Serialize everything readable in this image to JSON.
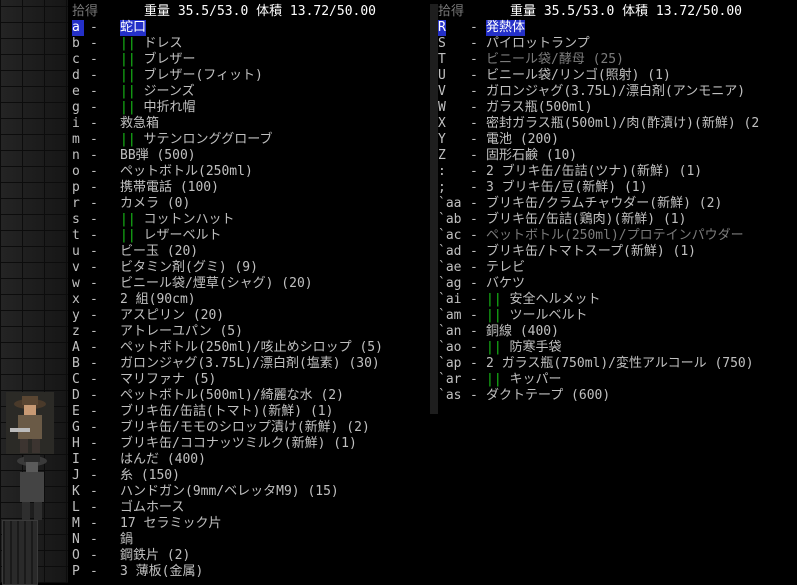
{
  "header": {
    "title": "拾得",
    "stats": "重量 35.5/53.0 体積 13.72/50.00"
  },
  "left_items": [
    {
      "key": "a",
      "name": "蛇口",
      "sel": true
    },
    {
      "key": "b",
      "worn": "||",
      "name": "ドレス"
    },
    {
      "key": "c",
      "worn": "||",
      "name": "ブレザー"
    },
    {
      "key": "d",
      "worn": "||",
      "name": "ブレザー(フィット)"
    },
    {
      "key": "e",
      "worn": "||",
      "name": "ジーンズ"
    },
    {
      "key": "g",
      "worn": "||",
      "name": "中折れ帽"
    },
    {
      "key": "i",
      "name": "救急箱"
    },
    {
      "key": "m",
      "worn": "||",
      "name": "サテンロンググローブ"
    },
    {
      "key": "n",
      "name": "BB弾 (500)"
    },
    {
      "key": "o",
      "name": "ペットボトル(250ml)"
    },
    {
      "key": "p",
      "name": "携帯電話 (100)"
    },
    {
      "key": "r",
      "name": "カメラ (0)"
    },
    {
      "key": "s",
      "worn": "||",
      "name": "コットンハット"
    },
    {
      "key": "t",
      "worn": "||",
      "name": "レザーベルト"
    },
    {
      "key": "u",
      "name": "ビー玉 (20)"
    },
    {
      "key": "v",
      "name": "ビタミン剤(グミ) (9)"
    },
    {
      "key": "w",
      "name": "ビニール袋/煙草(シャグ) (20)"
    },
    {
      "key": "x",
      "name": "2 組(90cm)"
    },
    {
      "key": "y",
      "name": "アスピリン (20)"
    },
    {
      "key": "z",
      "name": "アトレーユパン (5)"
    },
    {
      "key": "A",
      "name": "ペットボトル(250ml)/咳止めシロップ (5)"
    },
    {
      "key": "B",
      "name": "ガロンジャグ(3.75L)/漂白剤(塩素) (30)"
    },
    {
      "key": "C",
      "name": "マリファナ (5)"
    },
    {
      "key": "D",
      "name": "ペットボトル(500ml)/綺麗な水 (2)"
    },
    {
      "key": "E",
      "name": "ブリキ缶/缶詰(トマト)(新鮮) (1)"
    },
    {
      "key": "G",
      "name": "ブリキ缶/モモのシロップ漬け(新鮮) (2)"
    },
    {
      "key": "H",
      "name": "ブリキ缶/ココナッツミルク(新鮮) (1)"
    },
    {
      "key": "I",
      "name": "はんだ (400)"
    },
    {
      "key": "J",
      "name": "糸 (150)"
    },
    {
      "key": "K",
      "name": "ハンドガン(9mm/ベレッタM9) (15)"
    },
    {
      "key": "L",
      "name": "ゴムホース"
    },
    {
      "key": "M",
      "name": "17 セラミック片"
    },
    {
      "key": "N",
      "name": "鍋"
    },
    {
      "key": "O",
      "name": "鋼鉄片 (2)"
    },
    {
      "key": "P",
      "name": "3 薄板(金属)"
    }
  ],
  "right_items": [
    {
      "key": "R",
      "name": "発熱体",
      "sel": true
    },
    {
      "key": "S",
      "name": "パイロットランプ"
    },
    {
      "key": "T",
      "name": "ビニール袋/酵母 (25)",
      "gray": true
    },
    {
      "key": "U",
      "name": "ビニール袋/リンゴ(照射) (1)"
    },
    {
      "key": "V",
      "name": "ガロンジャグ(3.75L)/漂白剤(アンモニア)"
    },
    {
      "key": "W",
      "name": "ガラス瓶(500ml)"
    },
    {
      "key": "X",
      "name": "密封ガラス瓶(500ml)/肉(酢漬け)(新鮮) (2"
    },
    {
      "key": "Y",
      "name": "電池 (200)"
    },
    {
      "key": "Z",
      "name": "固形石鹸 (10)"
    },
    {
      "key": ":",
      "name": "2 ブリキ缶/缶詰(ツナ)(新鮮) (1)"
    },
    {
      "key": ";",
      "name": "3 ブリキ缶/豆(新鮮) (1)"
    },
    {
      "key": "`aa",
      "name": "ブリキ缶/クラムチャウダー(新鮮) (2)"
    },
    {
      "key": "`ab",
      "name": "ブリキ缶/缶詰(鶏肉)(新鮮) (1)"
    },
    {
      "key": "`ac",
      "name": "ペットボトル(250ml)/プロテインパウダー",
      "gray": true
    },
    {
      "key": "`ad",
      "name": "ブリキ缶/トマトスープ(新鮮) (1)"
    },
    {
      "key": "`ae",
      "name": "テレビ"
    },
    {
      "key": "`ag",
      "name": "バケツ"
    },
    {
      "key": "`ai",
      "worn": "||",
      "name": "安全ヘルメット"
    },
    {
      "key": "`am",
      "worn": "||",
      "name": "ツールベルト"
    },
    {
      "key": "`an",
      "name": "銅線 (400)"
    },
    {
      "key": "`ao",
      "worn": "||",
      "name": "防寒手袋"
    },
    {
      "key": "`ap",
      "name": "2 ガラス瓶(750ml)/変性アルコール (750)"
    },
    {
      "key": "`ar",
      "worn": "||",
      "name": "キッパー"
    },
    {
      "key": "`as",
      "name": "ダクトテープ (600)"
    }
  ]
}
